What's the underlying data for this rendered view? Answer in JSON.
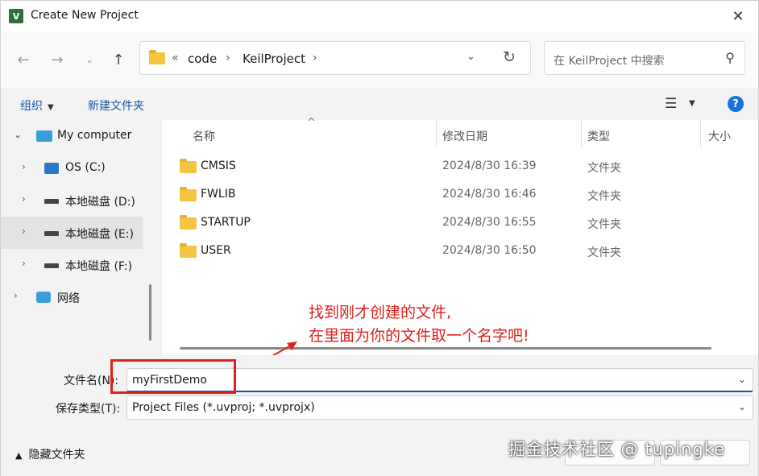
{
  "window": {
    "title": "Create New Project",
    "app_icon": "keil-uvision-icon"
  },
  "nav": {
    "back_icon": "arrow-left-icon",
    "forward_icon": "arrow-right-icon",
    "recent_icon": "chevron-down-icon",
    "up_icon": "arrow-up-icon",
    "breadcrumb": {
      "overflow": "«",
      "items": [
        "code",
        "KeilProject"
      ]
    },
    "refresh_icon": "refresh-icon",
    "search_placeholder": "在 KeilProject 中搜索"
  },
  "toolbar": {
    "organize": "组织",
    "new_folder": "新建文件夹",
    "view_icon": "list-view-icon",
    "help_icon": "help-icon"
  },
  "tree": [
    {
      "label": "My computer",
      "icon": "computer-icon",
      "expanded": true
    },
    {
      "label": "OS (C:)",
      "icon": "os-drive-icon"
    },
    {
      "label": "本地磁盘 (D:)",
      "icon": "drive-icon"
    },
    {
      "label": "本地磁盘 (E:)",
      "icon": "drive-icon",
      "selected": true
    },
    {
      "label": "本地磁盘 (F:)",
      "icon": "drive-icon"
    },
    {
      "label": "网络",
      "icon": "network-icon"
    }
  ],
  "columns": {
    "name": "名称",
    "date": "修改日期",
    "type": "类型",
    "size": "大小"
  },
  "files": [
    {
      "name": "CMSIS",
      "date": "2024/8/30 16:39",
      "type": "文件夹"
    },
    {
      "name": "FWLIB",
      "date": "2024/8/30 16:46",
      "type": "文件夹"
    },
    {
      "name": "STARTUP",
      "date": "2024/8/30 16:55",
      "type": "文件夹"
    },
    {
      "name": "USER",
      "date": "2024/8/30 16:50",
      "type": "文件夹"
    }
  ],
  "annotation": {
    "line1": "找到刚才创建的文件,",
    "line2": "在里面为你的文件取一个名字吧!"
  },
  "form": {
    "filename_label": "文件名(N):",
    "filename_value": "myFirstDemo",
    "filetype_label": "保存类型(T):",
    "filetype_value": "Project Files (*.uvproj; *.uvprojx)"
  },
  "footer": {
    "hide_folders": "隐藏文件夹",
    "watermark": "掘金技术社区 @ tupingke"
  },
  "colors": {
    "accent": "#1a56a8",
    "annotation": "#e0201c",
    "folder": "#f4c542"
  }
}
